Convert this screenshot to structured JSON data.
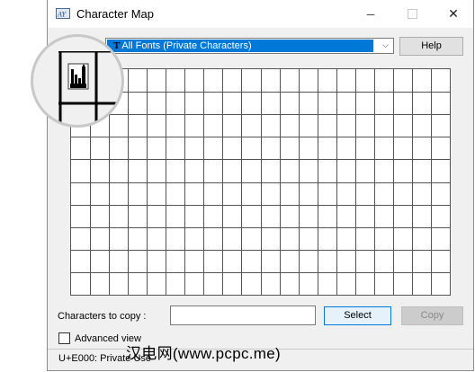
{
  "window": {
    "title": "Character Map"
  },
  "titlebar_controls": {
    "minimize_glyph": "─",
    "close_glyph": "✕"
  },
  "font_select": {
    "icon_glyph": "T",
    "value": "All Fonts (Private Characters)",
    "arrow_glyph": "⌵"
  },
  "buttons": {
    "help": "Help",
    "select": "Select",
    "copy": "Copy"
  },
  "grid": {
    "columns": 20,
    "rows": 10,
    "magnified_char": "private-use-glyph"
  },
  "copy_field": {
    "label": "Characters to copy :",
    "value": ""
  },
  "advanced_view": {
    "label": "Advanced view",
    "checked": false
  },
  "status": {
    "text": "U+E000: Private Use"
  },
  "watermark": {
    "text": "汉电网(www.pcpc.me)"
  },
  "colors": {
    "selection": "#0078d7",
    "select_border": "#0078d7"
  }
}
